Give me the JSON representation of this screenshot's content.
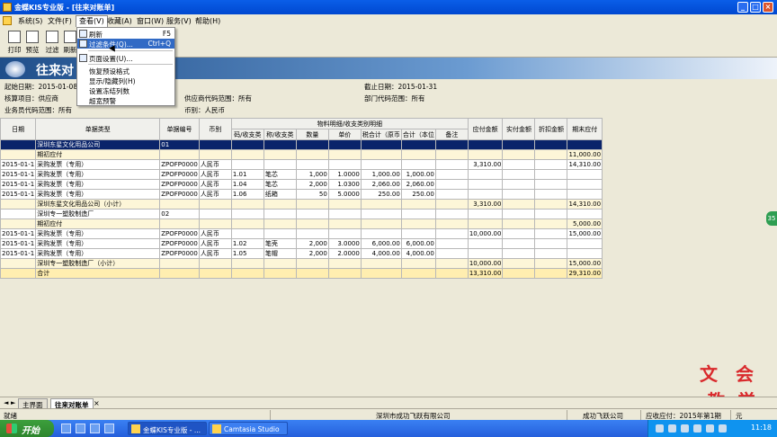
{
  "window": {
    "title": "金蝶KIS专业版 - [往来对账单]"
  },
  "menu": [
    "系统(S)",
    "文件(F)",
    "查看(V)",
    "收藏(A)",
    "窗口(W)",
    "服务(V)",
    "帮助(H)"
  ],
  "toolbar": [
    {
      "label": "打印"
    },
    {
      "label": "预览"
    },
    {
      "label": "过滤"
    },
    {
      "label": "刷新"
    }
  ],
  "dropdown": [
    {
      "label": "刷新",
      "shortcut": "F5"
    },
    {
      "label": "过滤条件(Q)...",
      "shortcut": "Ctrl+Q"
    },
    {
      "label": "页面设置(U)..."
    },
    {
      "label": "恢复预设格式"
    },
    {
      "label": "显示/隐藏列(H)"
    },
    {
      "label": "设置冻结列数"
    },
    {
      "label": "超宽预警"
    }
  ],
  "report": {
    "title": "往来对",
    "start_date": "起始日期：2015-01-08",
    "end_date": "截止日期：2015-01-31",
    "account_item": "核算项目：供应商",
    "supplier_range": "供应商代码范围：所有",
    "dept_range": "部门代码范围：所有",
    "staff_range": "业务员代码范围：所有",
    "currency": "币别：人民币"
  },
  "table": {
    "header_top": {
      "date": "日期",
      "doc_type": "单据类型",
      "doc_no": "单据编号",
      "currency": "币别",
      "material_group": "物料明细/收支类别明细",
      "payable": "应付金额",
      "paid": "实付金额",
      "discount": "折扣金额",
      "ending": "期末应付"
    },
    "header_sub": [
      "码/收支类",
      "称/收支类",
      "数量",
      "单价",
      "税合计（原币",
      "合计（本位",
      "备注"
    ],
    "rows": [
      {
        "kind": "sel",
        "cells": [
          "",
          "深圳东星文化用品公司",
          "01",
          "",
          "",
          "",
          "",
          "",
          "",
          "",
          "",
          "",
          "",
          "",
          ""
        ]
      },
      {
        "kind": "sub",
        "cells": [
          "",
          "期初应付",
          "",
          "",
          "",
          "",
          "",
          "",
          "",
          "",
          "",
          "",
          "",
          "",
          "11,000.00"
        ]
      },
      {
        "kind": "",
        "cells": [
          "2015-01-1",
          "采购发票（专用）",
          "ZPOFP0000",
          "人民币",
          "",
          "",
          "",
          "",
          "",
          "",
          "",
          "3,310.00",
          "",
          "",
          "14,310.00"
        ]
      },
      {
        "kind": "",
        "cells": [
          "2015-01-1",
          "采购发票（专用）",
          "ZPOFP0000",
          "人民币",
          "1.01",
          "笔芯",
          "1,000",
          "1.0000",
          "1,000.00",
          "1,000.00",
          "",
          "",
          "",
          "",
          ""
        ]
      },
      {
        "kind": "",
        "cells": [
          "2015-01-1",
          "采购发票（专用）",
          "ZPOFP0000",
          "人民币",
          "1.04",
          "笔芯",
          "2,000",
          "1.0300",
          "2,060.00",
          "2,060.00",
          "",
          "",
          "",
          "",
          ""
        ]
      },
      {
        "kind": "",
        "cells": [
          "2015-01-1",
          "采购发票（专用）",
          "ZPOFP0000",
          "人民币",
          "1.06",
          "纸箱",
          "50",
          "5.0000",
          "250.00",
          "250.00",
          "",
          "",
          "",
          "",
          ""
        ]
      },
      {
        "kind": "sub",
        "cells": [
          "",
          "深圳东星文化用品公司（小计）",
          "",
          "",
          "",
          "",
          "",
          "",
          "",
          "",
          "",
          "3,310.00",
          "",
          "",
          "14,310.00"
        ]
      },
      {
        "kind": "",
        "cells": [
          "",
          "深圳专一塑胶制造厂",
          "02",
          "",
          "",
          "",
          "",
          "",
          "",
          "",
          "",
          "",
          "",
          "",
          ""
        ]
      },
      {
        "kind": "sub",
        "cells": [
          "",
          "期初应付",
          "",
          "",
          "",
          "",
          "",
          "",
          "",
          "",
          "",
          "",
          "",
          "",
          "5,000.00"
        ]
      },
      {
        "kind": "",
        "cells": [
          "2015-01-1",
          "采购发票（专用）",
          "ZPOFP0000",
          "人民币",
          "",
          "",
          "",
          "",
          "",
          "",
          "",
          "10,000.00",
          "",
          "",
          "15,000.00"
        ]
      },
      {
        "kind": "",
        "cells": [
          "2015-01-1",
          "采购发票（专用）",
          "ZPOFP0000",
          "人民币",
          "1.02",
          "笔壳",
          "2,000",
          "3.0000",
          "6,000.00",
          "6,000.00",
          "",
          "",
          "",
          "",
          ""
        ]
      },
      {
        "kind": "",
        "cells": [
          "2015-01-1",
          "采购发票（专用）",
          "ZPOFP0000",
          "人民币",
          "1.05",
          "笔帽",
          "2,000",
          "2.0000",
          "4,000.00",
          "4,000.00",
          "",
          "",
          "",
          "",
          ""
        ]
      },
      {
        "kind": "sub",
        "cells": [
          "",
          "深圳专一塑胶制造厂（小计）",
          "",
          "",
          "",
          "",
          "",
          "",
          "",
          "",
          "",
          "10,000.00",
          "",
          "",
          "15,000.00"
        ]
      },
      {
        "kind": "tot",
        "cells": [
          "",
          "合计",
          "",
          "",
          "",
          "",
          "",
          "",
          "",
          "",
          "",
          "13,310.00",
          "",
          "",
          "29,310.00"
        ]
      }
    ]
  },
  "side_tab": "35",
  "watermark": [
    "文",
    "会",
    "教",
    "学"
  ],
  "tabs": [
    "主界面",
    "往来对账单"
  ],
  "status": {
    "ready": "就绪",
    "company": "深圳市成功飞跃有限公司",
    "company2": "成功飞跃公司",
    "period": "应收应付：2015年第1期",
    "mode": "元"
  },
  "taskbar": {
    "start": "开始",
    "tasks": [
      "金蝶KIS专业版 - ...",
      "Camtasia Studio ..."
    ],
    "clock": "11:18"
  }
}
